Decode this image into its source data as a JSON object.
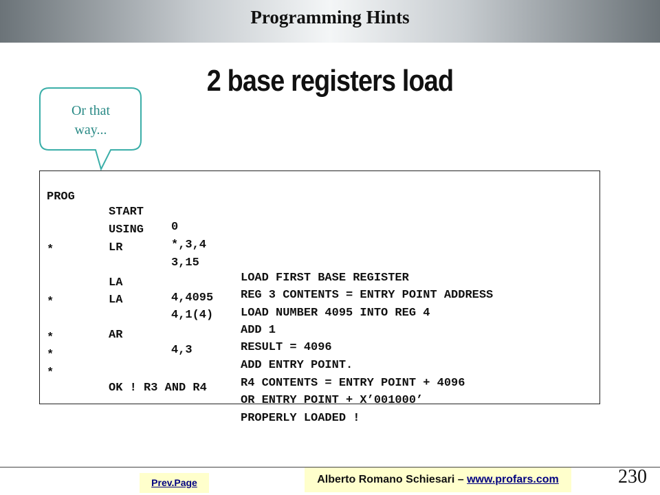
{
  "header": {
    "title": "Programming Hints"
  },
  "slide": {
    "title": "2 base registers load"
  },
  "callout": {
    "line1": "Or that",
    "line2": "way..."
  },
  "code": {
    "lines": [
      {
        "c1": "PROG",
        "c2": "START",
        "c3": "0",
        "c4": ""
      },
      {
        "c1": "",
        "c2": "USING",
        "c3": "*,3,4",
        "c4": ""
      },
      {
        "c1": "",
        "c2": "LR",
        "c3": "3,15",
        "c4": "LOAD FIRST BASE REGISTER"
      },
      {
        "c1": "*",
        "c2": "",
        "c3": "",
        "c4": "REG 3 CONTENTS = ENTRY POINT ADDRESS"
      },
      {
        "c1": "",
        "c2": "LA",
        "c3": "4,4095",
        "c4": "LOAD NUMBER 4095 INTO REG 4"
      },
      {
        "c1": "",
        "c2": "LA",
        "c3": "4,1(4)",
        "c4": "ADD 1"
      },
      {
        "c1": "*",
        "c2": "",
        "c3": "",
        "c4": "RESULT = 4096"
      },
      {
        "c1": "",
        "c2": "AR",
        "c3": "4,3",
        "c4": "ADD ENTRY POINT."
      },
      {
        "c1": "*",
        "c2": "",
        "c3": "",
        "c4": "R4 CONTENTS = ENTRY POINT + 4096"
      },
      {
        "c1": "*",
        "c2": "",
        "c3": "",
        "c4": "OR ENTRY POINT + X’001000’"
      },
      {
        "c1": "*",
        "c2": "OK ! R3 AND R4",
        "c3": "",
        "c4": "PROPERLY LOADED !"
      }
    ]
  },
  "footer": {
    "prev_page": "Prev.Page",
    "author": "Alberto Romano Schiesari – ",
    "author_link": "www.profars.com",
    "page_number": "230"
  }
}
